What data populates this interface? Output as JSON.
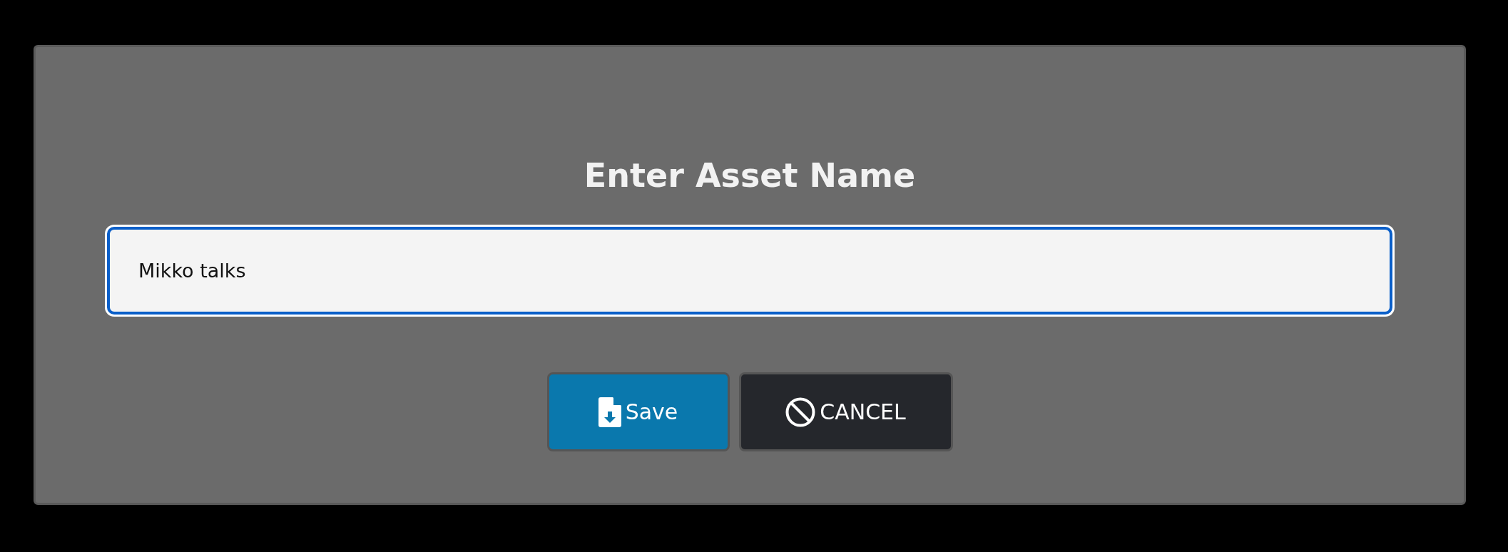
{
  "dialog": {
    "title": "Enter Asset Name",
    "field": {
      "value": "Mikko talks",
      "focused": true
    },
    "buttons": [
      {
        "kind": "save",
        "label": "Save"
      },
      {
        "kind": "cancel",
        "label": "CANCEL"
      }
    ]
  }
}
